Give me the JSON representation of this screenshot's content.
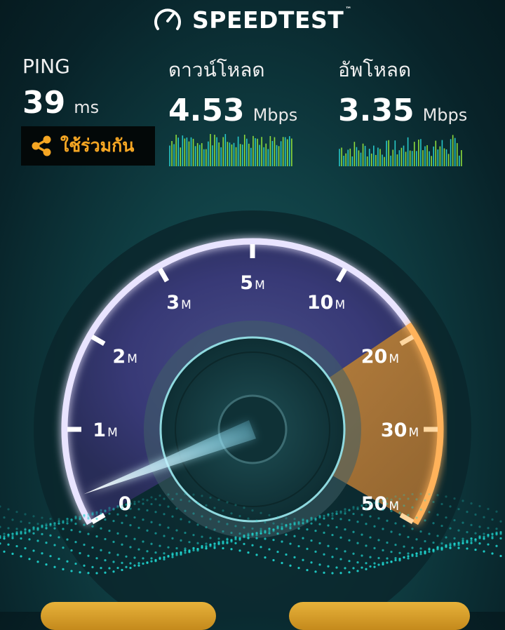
{
  "header": {
    "logo_text": "SPEEDTEST",
    "trademark": "™"
  },
  "metrics": {
    "ping": {
      "label": "PING",
      "value": "39",
      "unit": "ms"
    },
    "download": {
      "label": "ดาวน์โหลด",
      "value": "4.53",
      "unit": "Mbps"
    },
    "upload": {
      "label": "อัพโหลด",
      "value": "3.35",
      "unit": "Mbps"
    }
  },
  "share": {
    "label": "ใช้ร่วมกัน",
    "icon": "share-icon",
    "color": "#f5a623"
  },
  "gauge": {
    "ticks": [
      {
        "num": "0",
        "unit": ""
      },
      {
        "num": "1",
        "unit": "M"
      },
      {
        "num": "2",
        "unit": "M"
      },
      {
        "num": "3",
        "unit": "M"
      },
      {
        "num": "5",
        "unit": "M"
      },
      {
        "num": "10",
        "unit": "M"
      },
      {
        "num": "20",
        "unit": "M"
      },
      {
        "num": "30",
        "unit": "M"
      },
      {
        "num": "50",
        "unit": "M"
      }
    ],
    "reading_mbps": 0.3
  },
  "colors": {
    "accent": "#f5a623",
    "gauge_rim": "#b9a8ff",
    "wave": "#1fd6d0"
  }
}
